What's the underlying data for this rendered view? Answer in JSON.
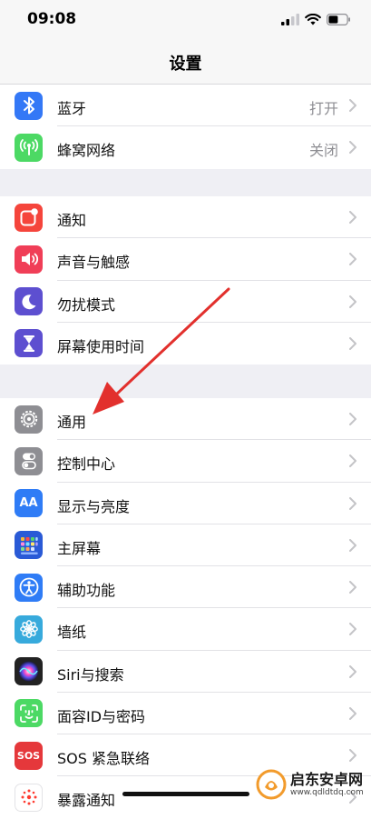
{
  "status_bar": {
    "time": "09:08"
  },
  "nav": {
    "title": "设置"
  },
  "groups": [
    {
      "rows": [
        {
          "label": "蓝牙",
          "value": "打开",
          "icon": "bluetooth-icon",
          "color": "#3478f6"
        },
        {
          "label": "蜂窝网络",
          "value": "关闭",
          "icon": "cellular-icon",
          "color": "#4cd964"
        }
      ]
    },
    {
      "rows": [
        {
          "label": "通知",
          "icon": "notifications-icon",
          "color": "#f5453c"
        },
        {
          "label": "声音与触感",
          "icon": "sound-icon",
          "color": "#f03e57"
        },
        {
          "label": "勿扰模式",
          "icon": "moon-icon",
          "color": "#5d4fd0"
        },
        {
          "label": "屏幕使用时间",
          "icon": "hourglass-icon",
          "color": "#5d4fd0"
        }
      ]
    },
    {
      "rows": [
        {
          "label": "通用",
          "icon": "gear-icon",
          "color": "#8e8e93"
        },
        {
          "label": "控制中心",
          "icon": "toggles-icon",
          "color": "#8e8e93"
        },
        {
          "label": "显示与亮度",
          "icon": "display-icon",
          "color": "#2f7cf6"
        },
        {
          "label": "主屏幕",
          "icon": "home-screen-icon",
          "color": "#2a5ad6"
        },
        {
          "label": "辅助功能",
          "icon": "accessibility-icon",
          "color": "#2f7cf6"
        },
        {
          "label": "墙纸",
          "icon": "wallpaper-icon",
          "color": "#37aadc"
        },
        {
          "label": "Siri与搜索",
          "icon": "siri-icon",
          "color": "#222222"
        },
        {
          "label": "面容ID与密码",
          "icon": "face-id-icon",
          "color": "#4cd964"
        },
        {
          "label": "SOS 紧急联络",
          "icon": "sos-icon",
          "color": "#e5383b"
        },
        {
          "label": "暴露通知",
          "icon": "exposure-icon",
          "color": "#ffffff"
        }
      ]
    }
  ],
  "icon_text": {
    "display": "AA",
    "sos": "SOS"
  },
  "watermark": {
    "name": "启东安卓网",
    "url": "www.qdldtdq.com"
  }
}
